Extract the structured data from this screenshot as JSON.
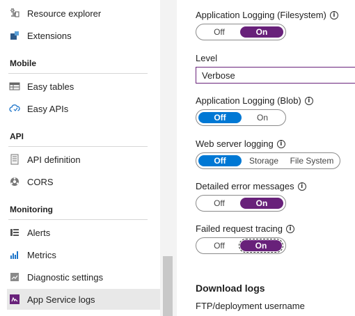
{
  "sidebar": {
    "items_top": [
      {
        "label": "Resource explorer",
        "icon": "resource-explorer-icon"
      },
      {
        "label": "Extensions",
        "icon": "extensions-icon"
      }
    ],
    "sections": [
      {
        "title": "Mobile",
        "items": [
          {
            "label": "Easy tables",
            "icon": "table-icon"
          },
          {
            "label": "Easy APIs",
            "icon": "cloud-icon"
          }
        ]
      },
      {
        "title": "API",
        "items": [
          {
            "label": "API definition",
            "icon": "document-icon"
          },
          {
            "label": "CORS",
            "icon": "cors-icon"
          }
        ]
      },
      {
        "title": "Monitoring",
        "items": [
          {
            "label": "Alerts",
            "icon": "alert-icon"
          },
          {
            "label": "Metrics",
            "icon": "metrics-icon"
          },
          {
            "label": "Diagnostic settings",
            "icon": "diagnostic-icon"
          },
          {
            "label": "App Service logs",
            "icon": "app-service-logs-icon",
            "selected": true
          }
        ]
      }
    ]
  },
  "main": {
    "app_logging_fs": {
      "label": "Application Logging (Filesystem)",
      "off": "Off",
      "on": "On",
      "value": "On"
    },
    "level": {
      "label": "Level",
      "value": "Verbose"
    },
    "app_logging_blob": {
      "label": "Application Logging (Blob)",
      "off": "Off",
      "on": "On",
      "value": "Off"
    },
    "web_server_logging": {
      "label": "Web server logging",
      "options": [
        "Off",
        "Storage",
        "File System"
      ],
      "value": "Off"
    },
    "detailed_errors": {
      "label": "Detailed error messages",
      "off": "Off",
      "on": "On",
      "value": "On"
    },
    "failed_request": {
      "label": "Failed request tracing",
      "off": "Off",
      "on": "On",
      "value": "On"
    },
    "download_logs": {
      "title": "Download logs",
      "ftp_label": "FTP/deployment username"
    }
  },
  "colors": {
    "accent_purple": "#68217a",
    "accent_blue": "#0078d4",
    "selected_bg": "#e8e8e8"
  }
}
